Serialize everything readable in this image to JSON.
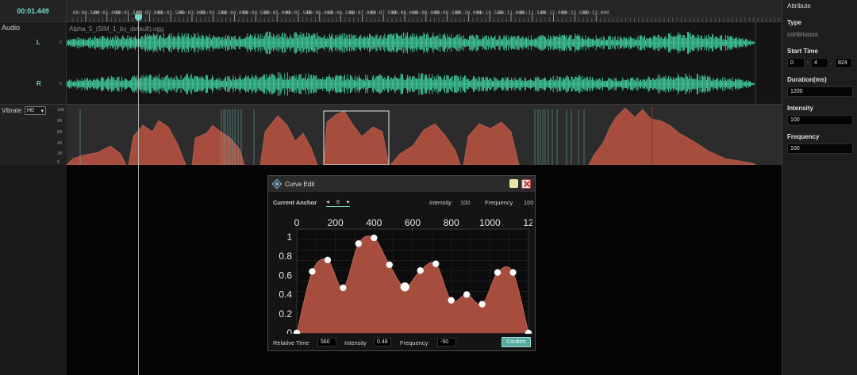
{
  "timeline": {
    "current_time": "00:01.449",
    "ticks": [
      "00:00.500",
      "00:01.000",
      "00:01.500",
      "00:02.000",
      "00:02.500",
      "00:03.000",
      "00:03.500",
      "00:04.000",
      "00:04.500",
      "00:05.000",
      "00:05.500",
      "00:06.000",
      "00:06.500",
      "00:07.000",
      "00:07.500",
      "00:08.000",
      "00:09.000",
      "00:09.500",
      "00:10.000",
      "00:10.500",
      "00:11.000",
      "00:11.500",
      "00:12.000",
      "00:12.500",
      "00:13.000"
    ]
  },
  "tracks": {
    "audio_label": "Audio",
    "left_channel": "L",
    "right_channel": "R",
    "zero": "0",
    "file_name": "Alpha_5_(SIM_1_by_default).ogg",
    "vibrate_label": "Vibrate",
    "vibrate_channel": "H0",
    "vibrate_axis": [
      "100",
      "80",
      "60",
      "40",
      "20",
      "0"
    ],
    "waveform_color": "#43d6a4",
    "envelope_color": "#a64d3e"
  },
  "attribute": {
    "title": "Attribute",
    "type_label": "Type",
    "type_value": "continuous",
    "start_time_label": "Start Time",
    "start_time_parts": [
      "0",
      "4",
      "824"
    ],
    "start_sep_1": ":",
    "start_sep_2": ".",
    "duration_label": "Duration(ms)",
    "duration_value": "1200",
    "intensity_label": "Intensity",
    "intensity_value": "100",
    "frequency_label": "Frequency",
    "frequency_value": "100"
  },
  "curve_edit": {
    "title": "Curve Edit",
    "current_anchor_label": "Current Anchor",
    "current_anchor_value": "8",
    "intensity_label": "Intensity",
    "intensity_value": "100",
    "frequency_label": "Frequency",
    "frequency_value": "100",
    "x_ticks": [
      "0",
      "200",
      "400",
      "600",
      "800",
      "1000",
      "12"
    ],
    "y_ticks": [
      "1",
      "0.8",
      "0.6",
      "0.4",
      "0.2",
      "0"
    ],
    "relative_time_label": "Relative Time",
    "relative_time_value": "560",
    "bottom_intensity_label": "Intensity",
    "bottom_intensity_value": "0.48",
    "bottom_frequency_label": "Frequency",
    "bottom_frequency_value": "-50",
    "confirm_label": "Confirm",
    "fill_color": "#a64d3e",
    "anchor_points": [
      {
        "t": 0,
        "v": 0
      },
      {
        "t": 80,
        "v": 0.64
      },
      {
        "t": 160,
        "v": 0.76
      },
      {
        "t": 240,
        "v": 0.47
      },
      {
        "t": 320,
        "v": 0.93
      },
      {
        "t": 400,
        "v": 0.99
      },
      {
        "t": 480,
        "v": 0.71
      },
      {
        "t": 560,
        "v": 0.48
      },
      {
        "t": 640,
        "v": 0.65
      },
      {
        "t": 720,
        "v": 0.72
      },
      {
        "t": 800,
        "v": 0.34
      },
      {
        "t": 880,
        "v": 0.4
      },
      {
        "t": 960,
        "v": 0.3
      },
      {
        "t": 1040,
        "v": 0.63
      },
      {
        "t": 1120,
        "v": 0.63
      },
      {
        "t": 1200,
        "v": 0
      }
    ],
    "selected_anchor_index": 7
  }
}
